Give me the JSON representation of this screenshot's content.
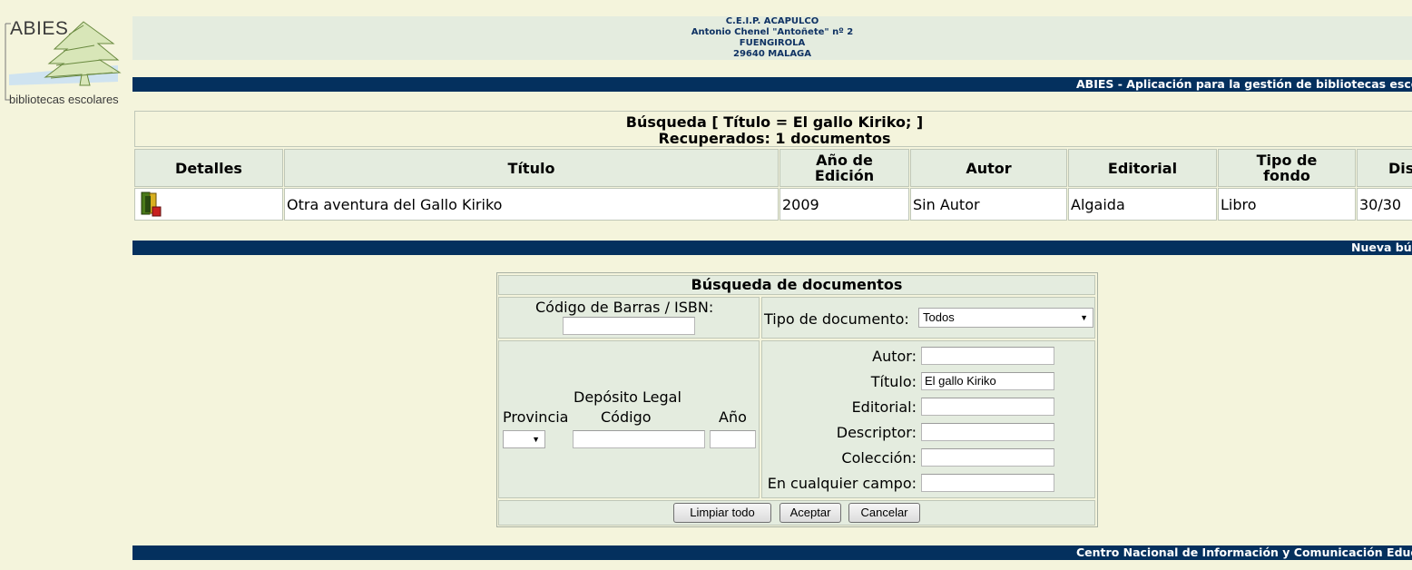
{
  "logo": {
    "name": "ABIES",
    "subtitle": "bibliotecas escolares"
  },
  "school": {
    "line1": "C.E.I.P. ACAPULCO",
    "line2": "Antonio Chenel \"Antoñete\" nº 2",
    "line3": "FUENGIROLA",
    "line4": "29640 MALAGA"
  },
  "top_bar": "ABIES - Aplicación para la gestión de bibliotecas escolares",
  "results": {
    "query": "Búsqueda [ Título = El gallo Kiriko; ]",
    "count": "Recuperados: 1 documentos",
    "headers": {
      "detalles": "Detalles",
      "titulo": "Título",
      "anio1": "Año de",
      "anio2": "Edición",
      "autor": "Autor",
      "editorial": "Editorial",
      "tipo1": "Tipo de",
      "tipo2": "fondo",
      "disp": "Disponibles"
    },
    "rows": [
      {
        "titulo": "Otra aventura del Gallo Kiriko",
        "anio": "2009",
        "autor": "Sin Autor",
        "editorial": "Algaida",
        "tipo": "Libro",
        "disp": "30/30"
      }
    ]
  },
  "new_search_bar": "Nueva búsqueda",
  "form": {
    "title": "Búsqueda de documentos",
    "barcode_label": "Código de Barras / ISBN:",
    "barcode_value": "",
    "doc_type_label": "Tipo de documento:",
    "doc_type_value": "Todos",
    "deposito_label": "Depósito Legal",
    "provincia_label": "Provincia",
    "codigo_label": "Código",
    "anio_label": "Año",
    "autor_label": "Autor:",
    "autor_value": "",
    "titulo_label": "Título:",
    "titulo_value": "El gallo Kiriko",
    "editorial_label": "Editorial:",
    "editorial_value": "",
    "descriptor_label": "Descriptor:",
    "descriptor_value": "",
    "coleccion_label": "Colección:",
    "coleccion_value": "",
    "cualquier_label": "En cualquier campo:",
    "cualquier_value": "",
    "btn_clear": "Limpiar todo",
    "btn_accept": "Aceptar",
    "btn_cancel": "Cancelar"
  },
  "footer_bar": "Centro Nacional de Información y Comunicación Educativa",
  "colors": {
    "bar": "#04305e",
    "panel": "#e4ecdf",
    "page": "#f4f4dc"
  }
}
